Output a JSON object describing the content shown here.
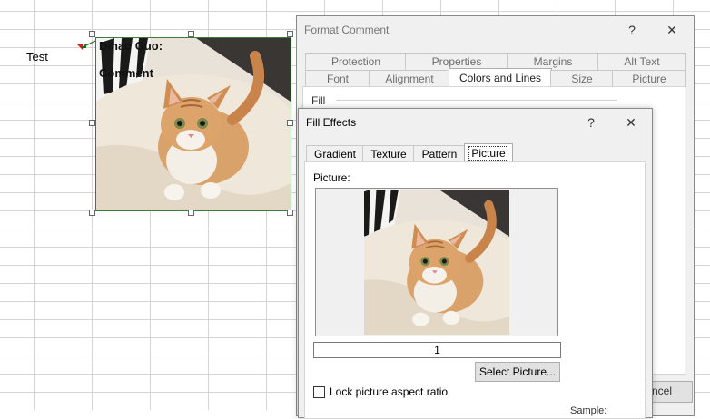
{
  "sheet": {
    "cell_text": "Test",
    "comment": {
      "author": "Dihao Guo:",
      "text": "Comment"
    }
  },
  "format_comment": {
    "title": "Format Comment",
    "help_glyph": "?",
    "close_glyph": "✕",
    "tabs_row1": [
      "Protection",
      "Properties",
      "Margins",
      "Alt Text"
    ],
    "tabs_row2": [
      "Font",
      "Alignment",
      "Colors and Lines",
      "Size",
      "Picture"
    ],
    "active_tab": "Colors and Lines",
    "section_fill": "Fill",
    "cancel_partial": "ncel"
  },
  "fill_effects": {
    "title": "Fill Effects",
    "help_glyph": "?",
    "close_glyph": "✕",
    "tabs": [
      "Gradient",
      "Texture",
      "Pattern",
      "Picture"
    ],
    "active_tab": "Picture",
    "picture_label": "Picture:",
    "picture_name": "1",
    "select_button": "Select Picture...",
    "lock_aspect_label": "Lock picture aspect ratio",
    "lock_aspect_checked": false,
    "sample_partial": "Sample:"
  }
}
